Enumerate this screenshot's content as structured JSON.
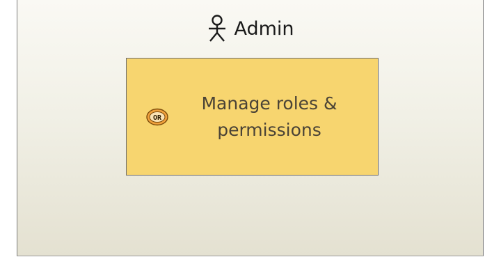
{
  "lane": {
    "title": "Admin",
    "actor_icon": "stick-figure-actor-icon"
  },
  "task": {
    "label": "Manage roles & permissions",
    "badge_icon": "or-operator-badge-icon",
    "badge_text": "OR"
  },
  "colors": {
    "task_fill": "#f7d56f",
    "task_border": "#6d6d6d",
    "lane_gradient_top": "#faf9f4",
    "lane_gradient_bottom": "#e4e1d1",
    "badge_fill": "#f0a13c"
  }
}
